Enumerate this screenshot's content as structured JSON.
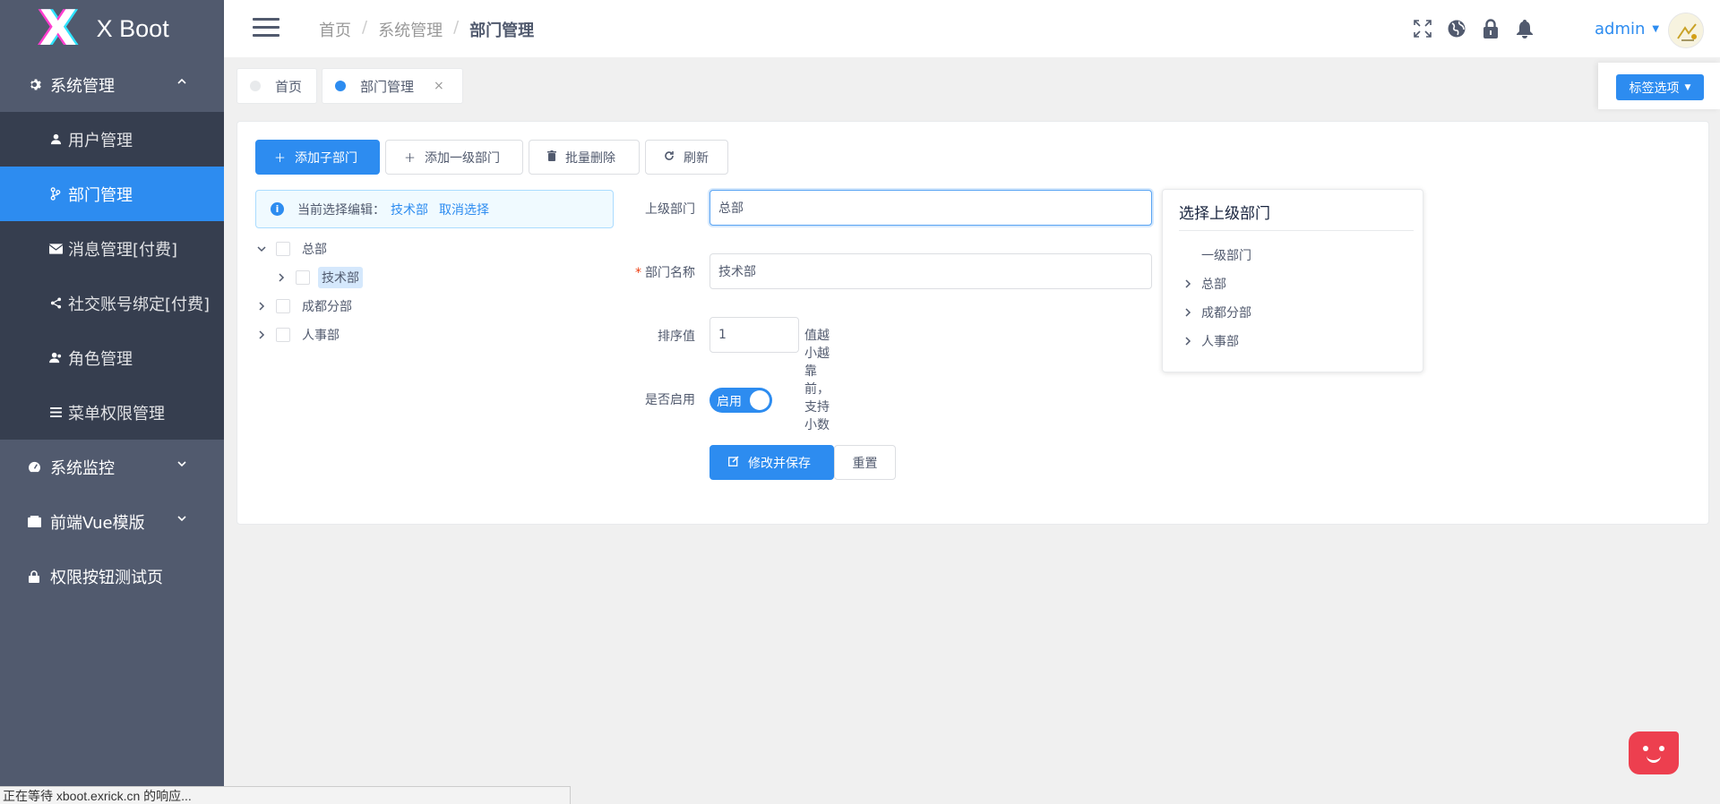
{
  "app": {
    "logo_letter": "X",
    "title": "X Boot"
  },
  "sidebar": {
    "groups": [
      {
        "label": "系统管理",
        "icon": "gear-icon",
        "expanded": true
      },
      {
        "label": "系统监控",
        "icon": "dashboard-icon",
        "expanded": false
      },
      {
        "label": "前端Vue模版",
        "icon": "box-icon",
        "expanded": false
      },
      {
        "label": "权限按钮测试页",
        "icon": "lock-icon"
      }
    ],
    "items": [
      {
        "label": "用户管理",
        "icon": "user-icon"
      },
      {
        "label": "部门管理",
        "icon": "branch-icon",
        "active": true
      },
      {
        "label": "消息管理[付费]",
        "icon": "mail-icon"
      },
      {
        "label": "社交账号绑定[付费]",
        "icon": "share-icon"
      },
      {
        "label": "角色管理",
        "icon": "role-icon"
      },
      {
        "label": "菜单权限管理",
        "icon": "list-icon"
      }
    ]
  },
  "header": {
    "breadcrumb": [
      "首页",
      "系统管理",
      "部门管理"
    ],
    "separator": "/",
    "icons": [
      "fullscreen-icon",
      "globe-icon",
      "lock-icon",
      "bell-icon"
    ],
    "username": "admin"
  },
  "tags": {
    "items": [
      {
        "label": "首页",
        "active": false
      },
      {
        "label": "部门管理",
        "active": true,
        "close": "×"
      }
    ],
    "options_label": "标签选项"
  },
  "toolbar": {
    "add_child": "添加子部门",
    "add_top": "添加一级部门",
    "batch_delete": "批量删除",
    "refresh": "刷新"
  },
  "alert": {
    "prefix": "当前选择编辑：",
    "selected": "技术部",
    "cancel": "取消选择"
  },
  "tree": [
    {
      "label": "总部",
      "expanded": true
    },
    {
      "label": "技术部",
      "selected": true
    },
    {
      "label": "成都分部"
    },
    {
      "label": "人事部"
    }
  ],
  "form": {
    "parent_label": "上级部门",
    "parent_value": "总部",
    "name_label": "部门名称",
    "name_required": "*",
    "name_value": "技术部",
    "sort_label": "排序值",
    "sort_value": "1",
    "sort_hint": "值越小越靠前，支持小数",
    "enabled_label": "是否启用",
    "enabled_text": "启用",
    "enabled": true,
    "save_label": "修改并保存",
    "reset_label": "重置"
  },
  "parent_picker": {
    "title": "选择上级部门",
    "nodes": [
      "一级部门",
      "总部",
      "成都分部",
      "人事部"
    ]
  },
  "status_bar": "正在等待 xboot.exrick.cn 的响应...",
  "colors": {
    "primary": "#2d8cf0",
    "sidebar": "#515a6e",
    "submenu": "#363e4f",
    "danger": "#ed3f4f"
  }
}
